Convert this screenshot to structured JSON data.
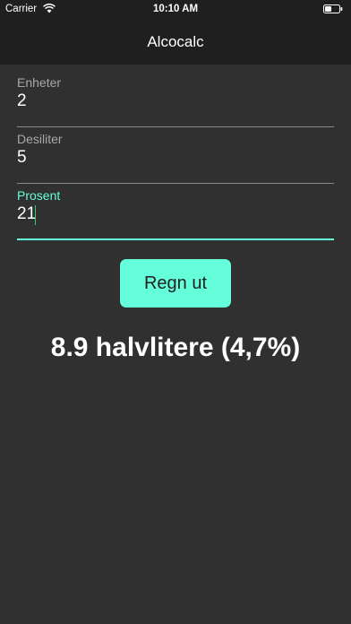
{
  "status_bar": {
    "carrier": "Carrier",
    "time": "10:10 AM",
    "wifi_icon": "wifi-icon",
    "battery_icon": "battery-icon"
  },
  "nav": {
    "title": "Alcocalc"
  },
  "form": {
    "fields": [
      {
        "label": "Enheter",
        "value": "2",
        "active": false
      },
      {
        "label": "Desiliter",
        "value": "5",
        "active": false
      },
      {
        "label": "Prosent",
        "value": "21",
        "active": true
      }
    ]
  },
  "button": {
    "label": "Regn ut"
  },
  "result": {
    "text": "8.9 halvlitere (4,7%)"
  },
  "colors": {
    "background": "#303030",
    "bar": "#1f1f1f",
    "accent": "#64ffda",
    "label_inactive": "#a8a8a8",
    "text": "#ffffff"
  }
}
